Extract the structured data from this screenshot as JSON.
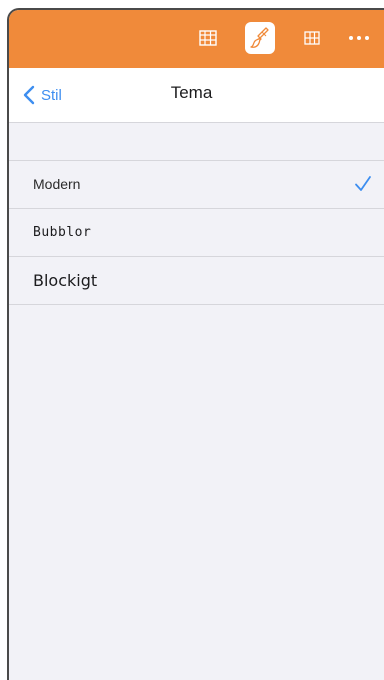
{
  "toolbar": {
    "icons": [
      "table-grid-icon",
      "paintbrush-icon",
      "grid-icon",
      "more-icon"
    ],
    "active": "paintbrush-icon",
    "color": "#f08a3a"
  },
  "nav": {
    "back_label": "Stil",
    "title": "Tema",
    "accent": "#3d8ef0"
  },
  "themes": [
    {
      "label": "Modern",
      "selected": true
    },
    {
      "label": "Bubblor",
      "selected": false
    },
    {
      "label": "Blockigt",
      "selected": false
    }
  ]
}
